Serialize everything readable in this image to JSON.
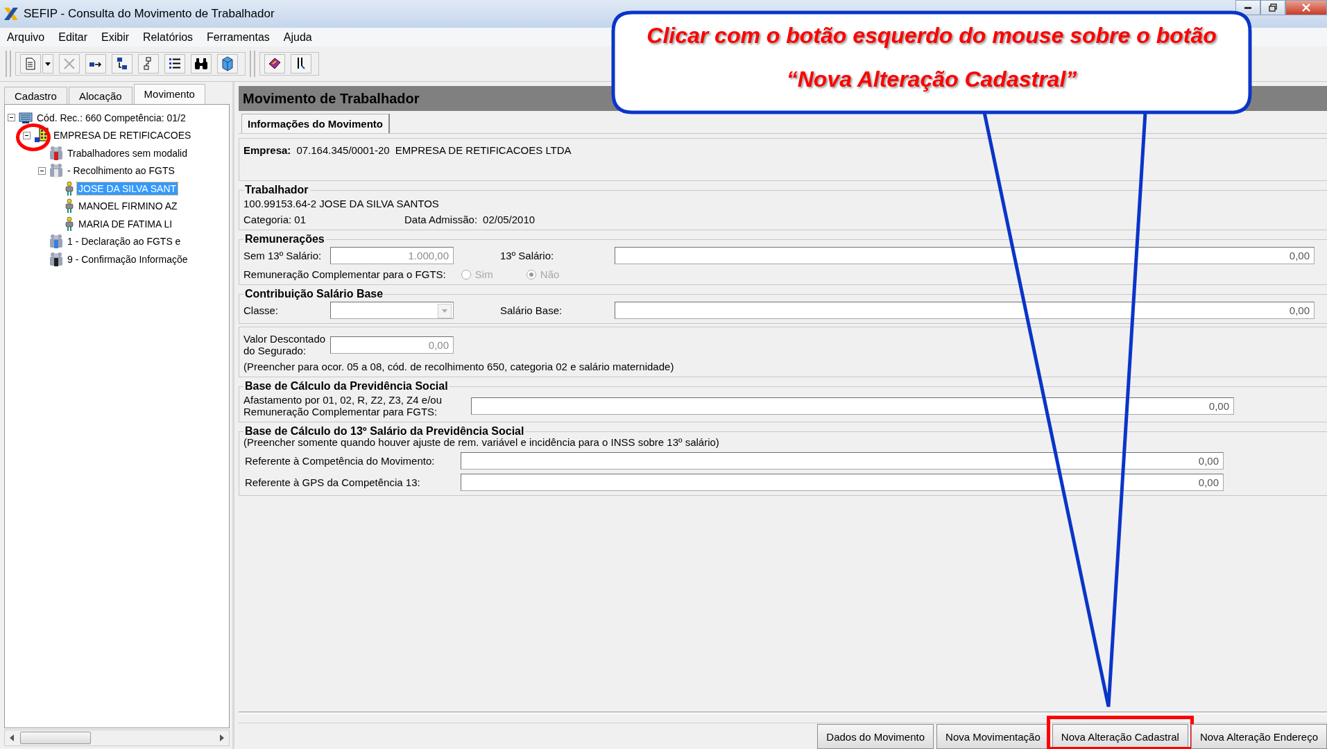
{
  "window": {
    "title": "SEFIP - Consulta do Movimento de Trabalhador"
  },
  "menu": [
    "Arquivo",
    "Editar",
    "Exibir",
    "Relatórios",
    "Ferramentas",
    "Ajuda"
  ],
  "left_tabs": [
    {
      "label": "Cadastro",
      "selected": false
    },
    {
      "label": "Alocação",
      "selected": false
    },
    {
      "label": "Movimento",
      "selected": true
    }
  ],
  "tree": [
    {
      "label": "Cód. Rec.: 660 Competência: 01/2",
      "kind": "contract",
      "expanded": true,
      "selected": false,
      "highlighted": false,
      "children": [
        {
          "label": "EMPRESA DE RETIFICACOES",
          "kind": "company",
          "expanded": true,
          "selected": false,
          "highlighted": true,
          "children": [
            {
              "label": "Trabalhadores sem modalid",
              "kind": "group",
              "color": "#d02020",
              "selected": false,
              "highlighted": false
            },
            {
              "label": "- Recolhimento ao FGTS",
              "kind": "group",
              "color": "#e8e8e8",
              "expanded": true,
              "selected": false,
              "highlighted": false,
              "children": [
                {
                  "label": "JOSE DA SILVA SANT",
                  "kind": "person",
                  "selected": true,
                  "highlighted": false
                },
                {
                  "label": "MANOEL FIRMINO AZ",
                  "kind": "person",
                  "selected": false,
                  "highlighted": false
                },
                {
                  "label": "MARIA DE FATIMA LI",
                  "kind": "person",
                  "selected": false,
                  "highlighted": false
                }
              ]
            },
            {
              "label": "1 - Declaração ao FGTS e",
              "kind": "group",
              "color": "#3a80d8",
              "selected": false,
              "highlighted": false
            },
            {
              "label": "9 - Confirmação Informaçõe",
              "kind": "group",
              "color": "#202020",
              "selected": false,
              "highlighted": false
            }
          ]
        }
      ]
    }
  ],
  "panel": {
    "title": "Movimento de Trabalhador",
    "tabs": [
      {
        "label": "Informações do Movimento",
        "selected": true
      }
    ],
    "empresa": {
      "label": "Empresa:",
      "cnpj": "07.164.345/0001-20",
      "name": "EMPRESA DE RETIFICACOES LTDA"
    },
    "trabalhador": {
      "legend": "Trabalhador",
      "id_name": "100.99153.64-2 JOSE DA SILVA SANTOS",
      "categoria": "Categoria: 01",
      "admissao_label": "Data Admissão:",
      "admissao": "02/05/2010"
    },
    "remuneracoes": {
      "legend": "Remunerações",
      "fields": [
        {
          "label": "Sem 13º Salário:",
          "value": "1.000,00",
          "disabled": true
        },
        {
          "label": "13º Salário:",
          "value": "0,00",
          "disabled": false
        }
      ],
      "radio_label": "Remuneração Complementar para o FGTS:",
      "options": [
        {
          "label": "Sim",
          "selected": false,
          "disabled": true
        },
        {
          "label": "Não",
          "selected": true,
          "disabled": true
        }
      ]
    },
    "contribuicao": {
      "legend": "Contribuição Salário Base",
      "classe_label": "Classe:",
      "classe_disabled": true,
      "base_label": "Salário Base:",
      "base_value": "0,00"
    },
    "desconto": {
      "label_lines": [
        "Valor Descontado",
        "do Segurado:"
      ],
      "value": "0,00",
      "disabled": true,
      "note": "(Preencher para ocor. 05 a 08, cód. de recolhimento 650, categoria 02 e salário maternidade)"
    },
    "base_prev": {
      "legend": "Base de Cálculo da Previdência Social",
      "label_lines": [
        "Afastamento por 01, 02, R, Z2, Z3, Z4 e/ou",
        "Remuneração Complementar para FGTS:"
      ],
      "value": "0,00"
    },
    "base_13": {
      "legend": "Base de Cálculo do 13º Salário da Previdência Social",
      "note": "(Preencher somente quando houver ajuste de rem. variável e incidência para o INSS sobre 13º salário)",
      "fields": [
        {
          "label": "Referente à Competência do Movimento:",
          "value": "0,00"
        },
        {
          "label": "Referente à GPS da Competência 13:",
          "value": "0,00"
        }
      ]
    }
  },
  "buttons": [
    {
      "label": "Dados do Movimento",
      "highlighted": false
    },
    {
      "label": "Nova Movimentação",
      "highlighted": false
    },
    {
      "label": "Nova Alteração Cadastral",
      "highlighted": true
    },
    {
      "label": "Nova Alteração Endereço",
      "highlighted": false
    }
  ],
  "callout": {
    "lines": [
      "Clicar com o botão esquerdo do mouse sobre o botão",
      "“Nova Alteração Cadastral”"
    ]
  }
}
